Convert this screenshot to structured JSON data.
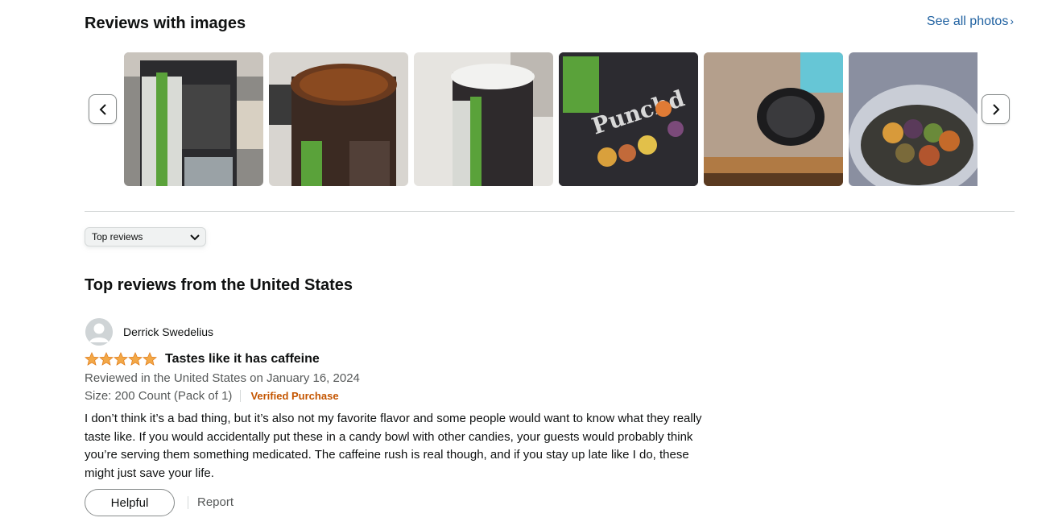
{
  "images_section": {
    "title": "Reviews with images",
    "see_all_label": "See all photos",
    "prev_icon": "chevron-left-icon",
    "next_icon": "chevron-right-icon",
    "thumbnails": [
      {
        "icon": "jar-side-photo"
      },
      {
        "icon": "jar-top-photo"
      },
      {
        "icon": "jar-lid-photo"
      },
      {
        "icon": "punchd-label-photo"
      },
      {
        "icon": "lid-on-tile-photo"
      },
      {
        "icon": "gummies-in-jar-photo"
      }
    ]
  },
  "sort": {
    "selected": "Top reviews",
    "icon": "chevron-down-icon"
  },
  "reviews_section": {
    "title": "Top reviews from the United States"
  },
  "review": {
    "reviewer_name": "Derrick Swedelius",
    "rating": 5,
    "star_color": "#ffa41c",
    "title": "Tastes like it has caffeine",
    "date_line": "Reviewed in the United States on January 16, 2024",
    "size": "Size: 200 Count (Pack of 1)",
    "verified": "Verified Purchase",
    "body": "I don’t think it’s a bad thing, but it’s also not my favorite flavor and some people would want to know what they really taste like. If you would accidentally put these in a candy bowl with other candies, your guests would probably think you’re serving them something medicated. The caffeine rush is real though, and if you stay up late like I do, these might just save your life.",
    "helpful_label": "Helpful",
    "report_label": "Report"
  }
}
